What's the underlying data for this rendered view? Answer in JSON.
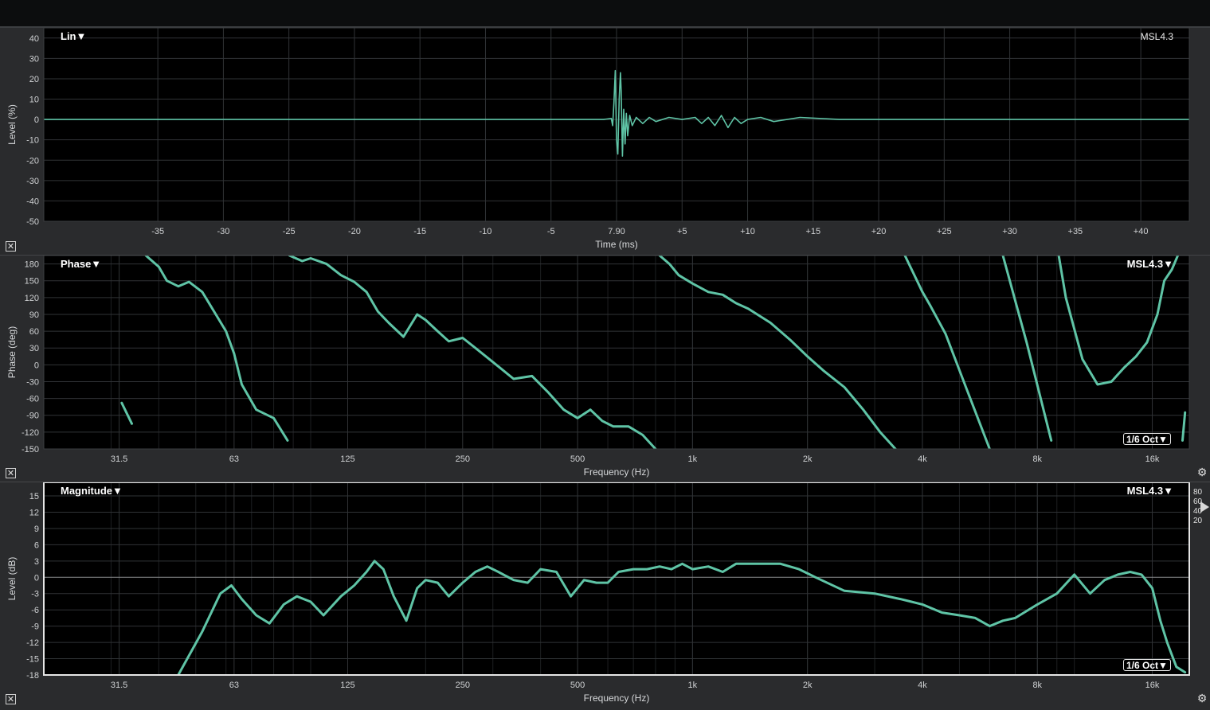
{
  "top_bar": {},
  "chart_data": [
    {
      "type": "line",
      "mode_label": "Lin▼",
      "measurement_label": "MSL4.3",
      "xlabel": "Time (ms)",
      "ylabel": "Level (%)",
      "xlim": [
        -43.7,
        43.7
      ],
      "ylim": [
        -50,
        45
      ],
      "x_ticks": [
        {
          "v": -35,
          "label": "-35"
        },
        {
          "v": -30,
          "label": "-30"
        },
        {
          "v": -25,
          "label": "-25"
        },
        {
          "v": -20,
          "label": "-20"
        },
        {
          "v": -15,
          "label": "-15"
        },
        {
          "v": -10,
          "label": "-10"
        },
        {
          "v": -5,
          "label": "-5"
        },
        {
          "v": 0,
          "label": "7.90"
        },
        {
          "v": 5,
          "label": "+5"
        },
        {
          "v": 10,
          "label": "+10"
        },
        {
          "v": 15,
          "label": "+15"
        },
        {
          "v": 20,
          "label": "+20"
        },
        {
          "v": 25,
          "label": "+25"
        },
        {
          "v": 30,
          "label": "+30"
        },
        {
          "v": 35,
          "label": "+35"
        },
        {
          "v": 40,
          "label": "+40"
        }
      ],
      "y_ticks": [
        40,
        30,
        20,
        10,
        0,
        -10,
        -20,
        -30,
        -40,
        -50
      ],
      "series": [
        {
          "color": "#5fc4a6",
          "x": [
            -43.7,
            -30,
            -15,
            -5,
            -1,
            -0.4,
            -0.3,
            -0.2,
            -0.1,
            0,
            0.1,
            0.2,
            0.3,
            0.35,
            0.45,
            0.55,
            0.65,
            0.75,
            0.85,
            1,
            1.2,
            1.5,
            2,
            2.5,
            3,
            4,
            5,
            6,
            6.5,
            7,
            7.5,
            8,
            8.5,
            9,
            9.5,
            10,
            11,
            12,
            14,
            17,
            20,
            25,
            30,
            35,
            40,
            43.7
          ],
          "y": [
            0,
            0,
            0,
            0,
            0,
            0.5,
            -3,
            8,
            24,
            -10,
            -17,
            10,
            23,
            14,
            -18,
            5,
            -12,
            3,
            -8,
            2,
            -3,
            1,
            -2,
            1,
            -1,
            1,
            0,
            1,
            -2,
            1,
            -3,
            2,
            -4,
            1,
            -2,
            0,
            1,
            -1,
            1,
            0,
            0,
            0,
            0,
            0,
            0,
            0
          ]
        }
      ]
    },
    {
      "type": "line",
      "mode_label": "Phase▼",
      "measurement_label": "MSL4.3▼",
      "smoothing_label": "1/6 Oct▼",
      "xlabel": "Frequency (Hz)",
      "ylabel": "Phase (deg)",
      "x_scale": "log",
      "xlim": [
        20,
        20000
      ],
      "ylim": [
        -150,
        195
      ],
      "x_ticks": [
        {
          "v": 31.5,
          "label": "31.5"
        },
        {
          "v": 63,
          "label": "63"
        },
        {
          "v": 125,
          "label": "125"
        },
        {
          "v": 250,
          "label": "250"
        },
        {
          "v": 500,
          "label": "500"
        },
        {
          "v": 1000,
          "label": "1k"
        },
        {
          "v": 2000,
          "label": "2k"
        },
        {
          "v": 4000,
          "label": "4k"
        },
        {
          "v": 8000,
          "label": "8k"
        },
        {
          "v": 16000,
          "label": "16k"
        }
      ],
      "y_ticks": [
        180,
        150,
        120,
        90,
        60,
        30,
        0,
        -30,
        -60,
        -90,
        -120,
        -150
      ],
      "series": [
        {
          "color": "#5fc4a6",
          "segments": [
            {
              "x": [
                32,
                34
              ],
              "y": [
                -68,
                -105
              ]
            },
            {
              "x": [
                37,
                40,
                42,
                45,
                48,
                52,
                60,
                63,
                66,
                72,
                80,
                87
              ],
              "y": [
                195,
                175,
                150,
                140,
                148,
                130,
                60,
                20,
                -35,
                -80,
                -95,
                -135
              ]
            },
            {
              "x": [
                88,
                95,
                100,
                110,
                120,
                130,
                140,
                150,
                160,
                175,
                190,
                200,
                215,
                230,
                250,
                270,
                300,
                340,
                380,
                420,
                460,
                500,
                540,
                580,
                620,
                680,
                740,
                800
              ],
              "y": [
                195,
                185,
                190,
                180,
                160,
                148,
                130,
                95,
                75,
                50,
                90,
                80,
                60,
                42,
                48,
                30,
                5,
                -25,
                -20,
                -50,
                -80,
                -95,
                -80,
                -100,
                -110,
                -110,
                -125,
                -150
              ]
            },
            {
              "x": [
                820,
                870,
                920,
                1000,
                1100,
                1200,
                1300,
                1400,
                1600,
                1800,
                2000,
                2200,
                2500,
                2800,
                3100,
                3400
              ],
              "y": [
                195,
                180,
                160,
                145,
                130,
                125,
                110,
                100,
                75,
                45,
                15,
                -10,
                -40,
                -80,
                -120,
                -150
              ]
            },
            {
              "x": [
                3600,
                4000,
                4200,
                4600,
                5200,
                6000
              ],
              "y": [
                195,
                130,
                105,
                55,
                -40,
                -150
              ]
            },
            {
              "x": [
                6500,
                7500,
                8700
              ],
              "y": [
                195,
                40,
                -135
              ]
            },
            {
              "x": [
                9100,
                9500,
                10500,
                11500,
                12500,
                13500,
                14500,
                15500,
                16500,
                17200,
                18000,
                18800
              ],
              "y": [
                195,
                120,
                10,
                -35,
                -30,
                -5,
                15,
                40,
                90,
                150,
                170,
                200
              ]
            },
            {
              "x": [
                19200,
                19500
              ],
              "y": [
                -135,
                -85
              ]
            }
          ]
        }
      ]
    },
    {
      "type": "line",
      "mode_label": "Magnitude▼",
      "measurement_label": "MSL4.3▼",
      "smoothing_label": "1/6 Oct▼",
      "xlabel": "Frequency (Hz)",
      "ylabel": "Level (dB)",
      "x_scale": "log",
      "xlim": [
        20,
        20000
      ],
      "ylim": [
        -18,
        17.5
      ],
      "x_ticks": [
        {
          "v": 31.5,
          "label": "31.5"
        },
        {
          "v": 63,
          "label": "63"
        },
        {
          "v": 125,
          "label": "125"
        },
        {
          "v": 250,
          "label": "250"
        },
        {
          "v": 500,
          "label": "500"
        },
        {
          "v": 1000,
          "label": "1k"
        },
        {
          "v": 2000,
          "label": "2k"
        },
        {
          "v": 4000,
          "label": "4k"
        },
        {
          "v": 8000,
          "label": "8k"
        },
        {
          "v": 16000,
          "label": "16k"
        }
      ],
      "y_ticks": [
        15,
        12,
        9,
        6,
        3,
        0,
        -3,
        -6,
        -9,
        -12,
        -15,
        -18
      ],
      "scale_labels": [
        "80",
        "60",
        "40",
        "20"
      ],
      "series": [
        {
          "color": "#5fc4a6",
          "x": [
            45,
            52,
            58,
            62,
            66,
            72,
            78,
            85,
            92,
            100,
            108,
            120,
            130,
            140,
            147,
            155,
            165,
            178,
            190,
            200,
            215,
            230,
            250,
            270,
            290,
            310,
            340,
            370,
            400,
            440,
            480,
            520,
            560,
            600,
            640,
            700,
            760,
            820,
            880,
            940,
            1000,
            1100,
            1200,
            1300,
            1500,
            1700,
            1900,
            2100,
            2500,
            3000,
            3500,
            4000,
            4500,
            5000,
            5500,
            6000,
            6500,
            7000,
            8000,
            9000,
            10000,
            11000,
            12000,
            13000,
            14000,
            15000,
            16000,
            16800,
            17500,
            18500,
            19500
          ],
          "y": [
            -18,
            -10,
            -3,
            -1.5,
            -4,
            -7,
            -8.5,
            -5,
            -3.5,
            -4.5,
            -7,
            -3.5,
            -1.5,
            1,
            3,
            1.5,
            -3.5,
            -8,
            -2,
            -0.5,
            -1,
            -3.5,
            -1,
            1,
            2,
            1,
            -0.5,
            -1,
            1.5,
            1,
            -3.5,
            -0.5,
            -1,
            -1,
            1,
            1.5,
            1.5,
            2,
            1.5,
            2.5,
            1.5,
            2,
            1,
            2.5,
            2.5,
            2.5,
            1.5,
            0,
            -2.5,
            -3,
            -4,
            -5,
            -6.5,
            -7,
            -7.5,
            -9,
            -8,
            -7.5,
            -5,
            -3,
            0.5,
            -3,
            -0.5,
            0.5,
            1,
            0.5,
            -2,
            -8,
            -12,
            -16.5,
            -17.5
          ]
        }
      ]
    }
  ]
}
